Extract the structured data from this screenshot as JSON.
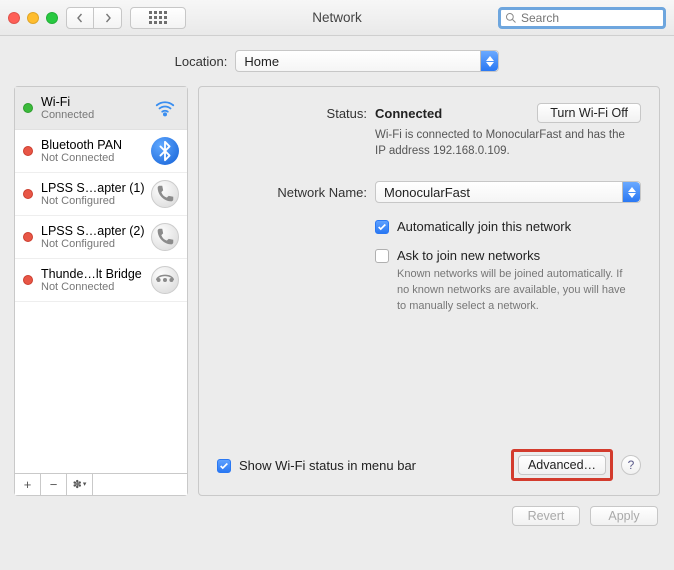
{
  "window": {
    "title": "Network",
    "search_placeholder": "Search"
  },
  "location": {
    "label": "Location:",
    "value": "Home"
  },
  "sidebar": {
    "items": [
      {
        "name": "Wi-Fi",
        "sub": "Connected",
        "status": "green",
        "icon": "wifi"
      },
      {
        "name": "Bluetooth PAN",
        "sub": "Not Connected",
        "status": "red",
        "icon": "bluetooth"
      },
      {
        "name": "LPSS S…apter (1)",
        "sub": "Not Configured",
        "status": "red",
        "icon": "phone"
      },
      {
        "name": "LPSS S…apter (2)",
        "sub": "Not Configured",
        "status": "red",
        "icon": "phone"
      },
      {
        "name": "Thunde…lt Bridge",
        "sub": "Not Connected",
        "status": "red",
        "icon": "bridge"
      }
    ],
    "add_label": "+",
    "remove_label": "−",
    "gear_label": "✽"
  },
  "detail": {
    "status_label": "Status:",
    "status_value": "Connected",
    "toggle_button": "Turn Wi-Fi Off",
    "status_desc": "Wi-Fi is connected to MonocularFast and has the IP address 192.168.0.109.",
    "network_label": "Network Name:",
    "network_value": "MonocularFast",
    "auto_join": "Automatically join this network",
    "ask_join": "Ask to join new networks",
    "ask_hint": "Known networks will be joined automatically. If no known networks are available, you will have to manually select a network.",
    "show_menubar": "Show Wi-Fi status in menu bar",
    "advanced_button": "Advanced…",
    "help_label": "?"
  },
  "actions": {
    "revert": "Revert",
    "apply": "Apply"
  }
}
